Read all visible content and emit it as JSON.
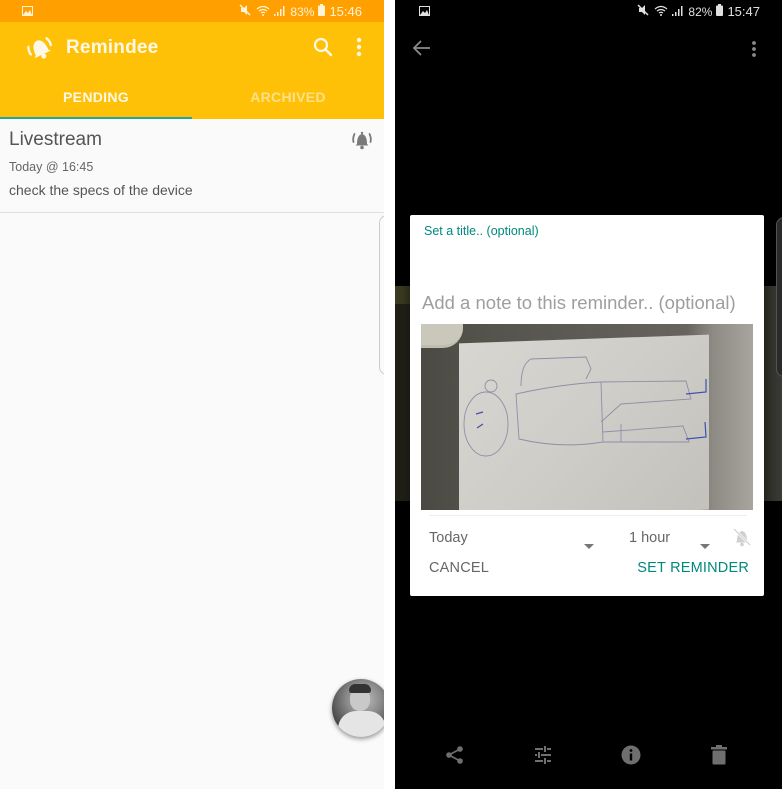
{
  "left_screen": {
    "status_bar": {
      "battery": "83%",
      "time": "15:46",
      "icons": [
        "gallery-icon",
        "mute-icon",
        "wifi-icon",
        "signal-icon",
        "battery-icon"
      ]
    },
    "app_bar": {
      "title": "Remindee",
      "logo_icon": "ringing-bell-icon",
      "actions": [
        "search-icon",
        "more-vert-icon"
      ]
    },
    "tabs": [
      {
        "label": "PENDING",
        "active": true
      },
      {
        "label": "ARCHIVED",
        "active": false
      }
    ],
    "reminders": [
      {
        "title": "Livestream",
        "time": "Today @ 16:45",
        "note": "check the specs of the device",
        "icon": "ringing-bell-icon"
      }
    ],
    "colors": {
      "status_bar": "#ffa000",
      "app_bar": "#ffc107",
      "tab_indicator": "#26a69a",
      "background": "#fafafa"
    }
  },
  "right_screen": {
    "status_bar": {
      "battery": "82%",
      "time": "15:47",
      "icons": [
        "gallery-icon",
        "mute-icon",
        "wifi-icon",
        "signal-icon",
        "battery-icon"
      ]
    },
    "top_actions": [
      "back-arrow-icon",
      "more-vert-icon"
    ],
    "dialog": {
      "title_label": "Set a title.. (optional)",
      "title_value": "",
      "note_placeholder": "Add a note to this reminder.. (optional)",
      "note_value": "",
      "attachment": "photo of a pen drawing of a figure on paper",
      "date_select": "Today",
      "time_select": "1 hour",
      "notification_icon": "bell-off-icon",
      "cancel_label": "CANCEL",
      "confirm_label": "SET REMINDER"
    },
    "bottom_bar": [
      "share-icon",
      "adjust-icon",
      "info-icon",
      "delete-icon"
    ],
    "colors": {
      "accent": "#00897b",
      "background": "#000000",
      "dialog": "#ffffff"
    }
  }
}
